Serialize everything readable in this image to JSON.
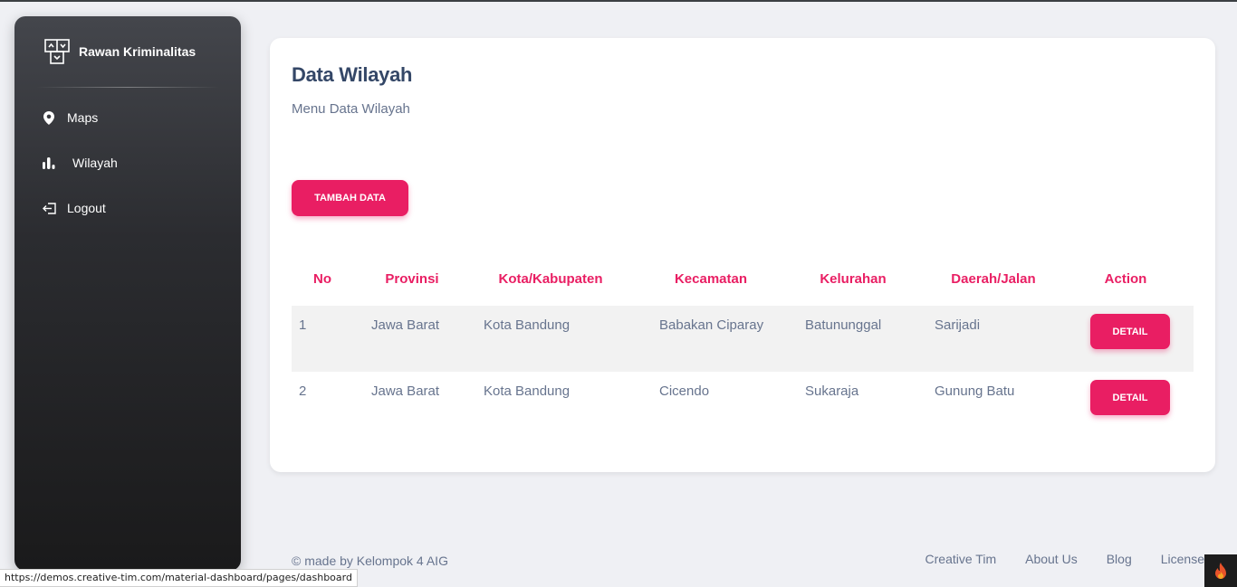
{
  "sidebar": {
    "brand": {
      "icon": "brand-logo-icon",
      "name": "Rawan Kriminalitas"
    },
    "items": [
      {
        "icon": "map-pin-icon",
        "label": "Maps"
      },
      {
        "icon": "chart-icon",
        "label": "Wilayah"
      },
      {
        "icon": "logout-icon",
        "label": "Logout"
      }
    ]
  },
  "main": {
    "title": "Data Wilayah",
    "subtitle": "Menu Data Wilayah",
    "add_button": "TAMBAH DATA",
    "table": {
      "headers": [
        "No",
        "Provinsi",
        "Kota/Kabupaten",
        "Kecamatan",
        "Kelurahan",
        "Daerah/Jalan",
        "Action"
      ],
      "rows": [
        {
          "no": "1",
          "provinsi": "Jawa Barat",
          "kota": "Kota Bandung",
          "kecamatan": "Babakan Ciparay",
          "kelurahan": "Batununggal",
          "daerah": "Sarijadi",
          "action": "DETAIL"
        },
        {
          "no": "2",
          "provinsi": "Jawa Barat",
          "kota": "Kota Bandung",
          "kecamatan": "Cicendo",
          "kelurahan": "Sukaraja",
          "daerah": "Gunung Batu",
          "action": "DETAIL"
        }
      ]
    }
  },
  "footer": {
    "copyright": "© made by Kelompok 4 AIG",
    "links": [
      "Creative Tim",
      "About Us",
      "Blog",
      "License"
    ]
  },
  "status_bar": {
    "url": "https://demos.creative-tim.com/material-dashboard/pages/dashboard"
  },
  "colors": {
    "accent": "#e91e63",
    "heading": "#344767",
    "text": "#67748e"
  }
}
